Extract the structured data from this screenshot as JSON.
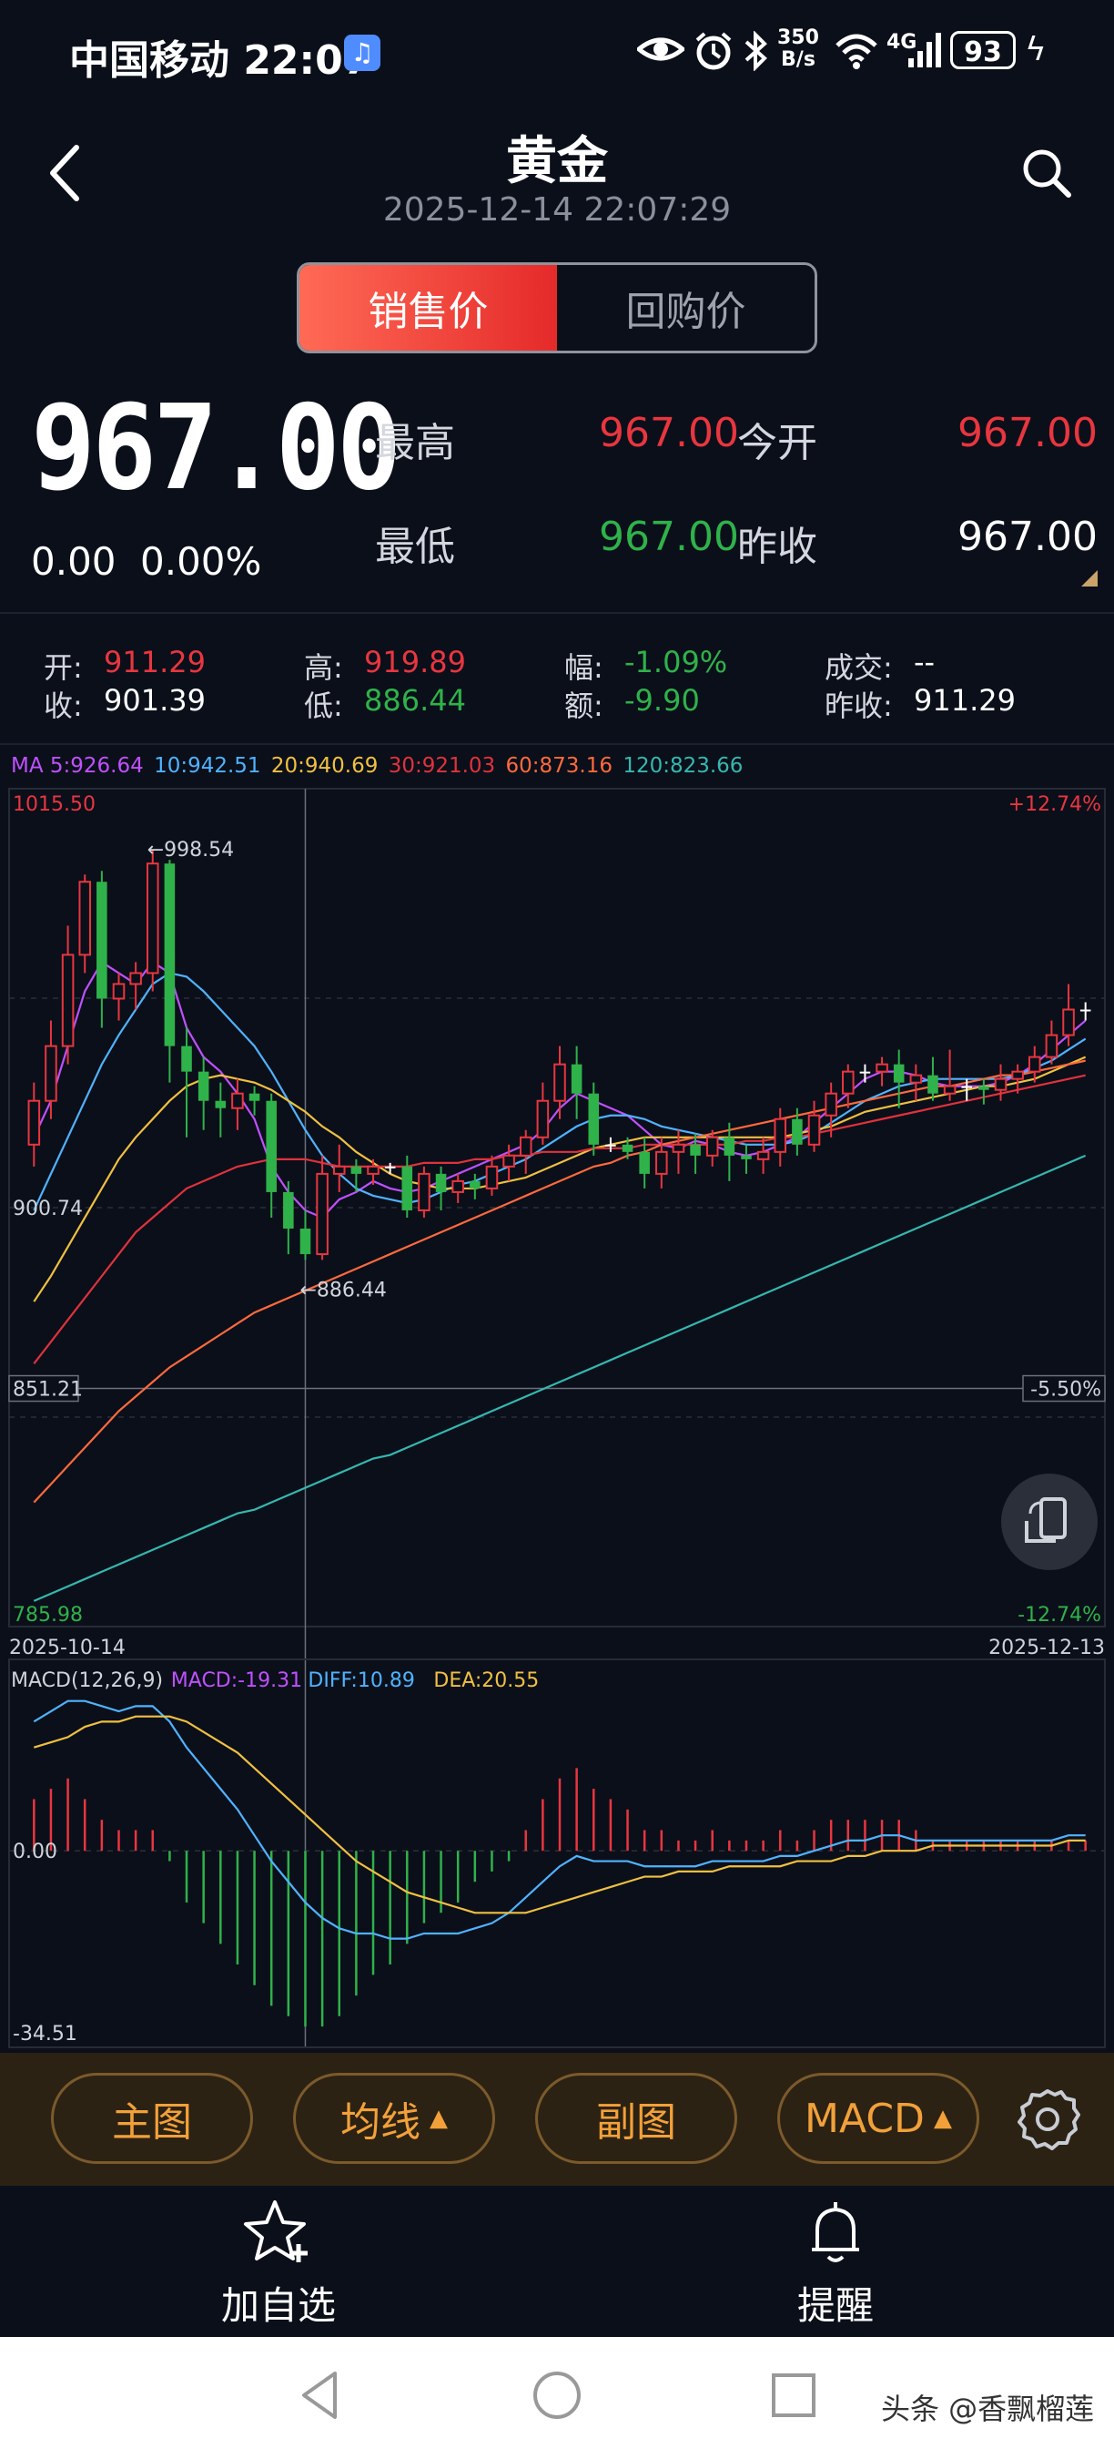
{
  "status_bar": {
    "carrier_time": "中国移动 22:07",
    "net_speed_value": "350",
    "net_speed_unit": "B/s",
    "network": "4G",
    "battery": "93"
  },
  "header": {
    "title": "黄金",
    "datetime": "2025-12-14 22:07:29"
  },
  "tabs": [
    {
      "label": "销售价",
      "active": true
    },
    {
      "label": "回购价",
      "active": false
    }
  ],
  "quote": {
    "price": "967.00",
    "change": "0.00",
    "change_pct": "0.00%",
    "high_label": "最高",
    "high": "967.00",
    "low_label": "最低",
    "low": "967.00",
    "open_label": "今开",
    "open": "967.00",
    "prev_close_label": "昨收",
    "prev_close": "967.00"
  },
  "ohlc": {
    "open_label": "开:",
    "open": "911.29",
    "close_label": "收:",
    "close": "901.39",
    "high_label": "高:",
    "high": "919.89",
    "low_label": "低:",
    "low": "886.44",
    "range_label": "幅:",
    "range": "-1.09%",
    "amount_label": "额:",
    "amount": "-9.90",
    "volume_label": "成交:",
    "volume": "--",
    "prev_close_label": "昨收:",
    "prev_close": "911.29"
  },
  "ma_legend": {
    "ma5": "MA 5:926.64",
    "ma10": "10:942.51",
    "ma20": "20:940.69",
    "ma30": "30:921.03",
    "ma60": "60:873.16",
    "ma120": "120:823.66"
  },
  "colors": {
    "ma5": "#c050ff",
    "ma10": "#4fb3ff",
    "ma20": "#f0c040",
    "ma30": "#e0323c",
    "ma60": "#ff6a3d",
    "ma120": "#34b8b0",
    "up": "#e8363f",
    "down": "#2fb24a",
    "accent": "#f2a13a"
  },
  "chart_data": [
    {
      "type": "candlestick",
      "title": "",
      "ylim": [
        785.98,
        1015.5
      ],
      "y_labels": [
        "1015.50",
        "900.74",
        "851.21",
        "785.98"
      ],
      "pct_labels": [
        "+12.74%",
        "-5.50%",
        "-12.74%"
      ],
      "x_range": [
        "2025-10-14",
        "2025-12-13"
      ],
      "annotations": [
        "←998.54",
        "←886.44"
      ],
      "candles": [
        [
          918,
          930,
          912,
          935
        ],
        [
          930,
          945,
          925,
          952
        ],
        [
          945,
          970,
          940,
          978
        ],
        [
          970,
          990,
          965,
          992
        ],
        [
          990,
          958,
          950,
          993
        ],
        [
          958,
          962,
          952,
          965
        ],
        [
          962,
          965,
          955,
          968
        ],
        [
          965,
          995,
          960,
          998.54
        ],
        [
          995,
          945,
          935,
          996
        ],
        [
          945,
          938,
          920,
          950
        ],
        [
          938,
          930,
          922,
          942
        ],
        [
          930,
          928,
          920,
          935
        ],
        [
          928,
          932,
          922,
          936
        ],
        [
          932,
          930,
          926,
          934
        ],
        [
          930,
          905,
          898,
          932
        ],
        [
          905,
          895,
          888,
          908
        ],
        [
          895,
          888,
          886.44,
          900
        ],
        [
          888,
          910,
          886.44,
          915
        ],
        [
          910,
          912,
          905,
          918
        ],
        [
          912,
          910,
          905,
          914
        ],
        [
          910,
          912,
          907,
          914
        ],
        [
          912,
          912,
          910,
          913
        ],
        [
          912,
          900,
          898,
          915
        ],
        [
          900,
          910,
          898,
          912
        ],
        [
          910,
          905,
          900,
          912
        ],
        [
          905,
          908,
          902,
          910
        ],
        [
          908,
          906,
          903,
          910
        ],
        [
          906,
          912,
          904,
          915
        ],
        [
          912,
          915,
          908,
          918
        ],
        [
          915,
          920,
          910,
          922
        ],
        [
          920,
          930,
          918,
          935
        ],
        [
          930,
          940,
          925,
          945
        ],
        [
          940,
          932,
          925,
          945
        ],
        [
          932,
          918,
          915,
          935
        ],
        [
          918,
          918,
          916,
          920
        ],
        [
          918,
          916,
          914,
          920
        ],
        [
          916,
          910,
          906,
          920
        ],
        [
          910,
          916,
          906,
          920
        ],
        [
          916,
          918,
          910,
          922
        ],
        [
          918,
          915,
          910,
          921
        ],
        [
          915,
          920,
          912,
          922
        ],
        [
          920,
          915,
          908,
          924
        ],
        [
          915,
          914,
          910,
          918
        ],
        [
          914,
          916,
          910,
          920
        ],
        [
          916,
          925,
          912,
          928
        ],
        [
          925,
          918,
          915,
          928
        ],
        [
          918,
          926,
          916,
          930
        ],
        [
          926,
          932,
          920,
          935
        ],
        [
          932,
          938,
          928,
          940
        ],
        [
          938,
          938,
          935,
          940
        ],
        [
          938,
          940,
          934,
          942
        ],
        [
          940,
          935,
          928,
          944
        ],
        [
          935,
          937,
          930,
          940
        ],
        [
          937,
          932,
          930,
          942
        ],
        [
          932,
          934,
          930,
          944
        ],
        [
          934,
          934,
          930,
          936
        ],
        [
          934,
          933,
          929,
          936
        ],
        [
          933,
          936,
          930,
          940
        ],
        [
          936,
          938,
          932,
          940
        ],
        [
          938,
          942,
          935,
          945
        ],
        [
          942,
          948,
          940,
          952
        ],
        [
          948,
          955,
          945,
          962
        ],
        [
          955,
          955,
          952,
          957
        ]
      ],
      "series": [
        {
          "name": "MA 5",
          "color": "#c050ff",
          "values": [
            920,
            930,
            945,
            960,
            968,
            965,
            962,
            968,
            965,
            950,
            942,
            938,
            932,
            925,
            912,
            905,
            900,
            898,
            903,
            905,
            908,
            906,
            905,
            906,
            908,
            910,
            912,
            914,
            916,
            918,
            922,
            928,
            932,
            930,
            928,
            926,
            922,
            918,
            917,
            919,
            918,
            916,
            915,
            916,
            918,
            920,
            924,
            928,
            932,
            936,
            938,
            938,
            937,
            935,
            934,
            934,
            934,
            935,
            937,
            940,
            944,
            948,
            952
          ]
        },
        {
          "name": "10",
          "color": "#4fb3ff",
          "values": [
            900,
            910,
            920,
            930,
            940,
            948,
            955,
            962,
            965,
            964,
            960,
            955,
            950,
            945,
            938,
            930,
            922,
            915,
            910,
            906,
            904,
            903,
            902,
            903,
            905,
            907,
            908,
            910,
            912,
            914,
            917,
            920,
            923,
            925,
            926,
            926,
            925,
            923,
            922,
            921,
            920,
            919,
            918,
            918,
            918,
            919,
            921,
            924,
            927,
            930,
            932,
            934,
            935,
            936,
            936,
            936,
            936,
            936,
            937,
            939,
            941,
            944,
            947
          ]
        },
        {
          "name": "20",
          "color": "#f0c040",
          "values": [
            875,
            882,
            890,
            898,
            906,
            914,
            920,
            925,
            930,
            934,
            936,
            937,
            936,
            935,
            933,
            930,
            927,
            923,
            920,
            916,
            913,
            910,
            908,
            907,
            906,
            906,
            906,
            907,
            908,
            909,
            911,
            913,
            915,
            917,
            918,
            919,
            920,
            920,
            920,
            920,
            920,
            920,
            920,
            920,
            920,
            921,
            922,
            923,
            925,
            927,
            928,
            929,
            930,
            931,
            932,
            933,
            934,
            934,
            935,
            936,
            938,
            940,
            942
          ]
        },
        {
          "name": "30",
          "color": "#e0323c",
          "values": [
            858,
            864,
            870,
            876,
            882,
            888,
            894,
            898,
            902,
            906,
            908,
            910,
            912,
            913,
            914,
            914,
            914,
            913,
            912,
            912,
            912,
            912,
            912,
            913,
            913,
            913,
            914,
            914,
            915,
            915,
            916,
            916,
            916,
            917,
            917,
            917,
            918,
            918,
            918,
            918,
            918,
            918,
            919,
            919,
            920,
            920,
            921,
            922,
            923,
            924,
            925,
            926,
            927,
            928,
            929,
            930,
            931,
            932,
            933,
            934,
            935,
            936,
            937
          ]
        },
        {
          "name": "60",
          "color": "#ff6a3d",
          "values": [
            820,
            825,
            830,
            835,
            840,
            845,
            849,
            853,
            857,
            860,
            863,
            866,
            869,
            872,
            874,
            876,
            878,
            880,
            882,
            884,
            886,
            888,
            890,
            892,
            894,
            896,
            898,
            900,
            902,
            904,
            906,
            908,
            910,
            912,
            913,
            915,
            916,
            918,
            919,
            920,
            921,
            922,
            923,
            924,
            925,
            926,
            927,
            928,
            929,
            930,
            931,
            932,
            933,
            934,
            934,
            935,
            936,
            937,
            937,
            938,
            939,
            940,
            941
          ]
        },
        {
          "name": "120",
          "color": "#34b8b0",
          "values": [
            793,
            795,
            797,
            799,
            801,
            803,
            805,
            807,
            809,
            811,
            813,
            815,
            817,
            818,
            820,
            822,
            824,
            826,
            828,
            830,
            832,
            833,
            835,
            837,
            839,
            841,
            843,
            845,
            847,
            849,
            851,
            853,
            855,
            857,
            859,
            861,
            863,
            865,
            867,
            869,
            871,
            873,
            875,
            877,
            879,
            881,
            883,
            885,
            887,
            889,
            891,
            893,
            895,
            897,
            899,
            901,
            903,
            905,
            907,
            909,
            911,
            913,
            915
          ]
        }
      ]
    },
    {
      "type": "macd",
      "legend": {
        "label": "MACD(12,26,9)",
        "macd": "MACD:-19.31",
        "diff": "DIFF:10.89",
        "dea": "DEA:20.55"
      },
      "y_labels": [
        "0.00",
        "-34.51"
      ],
      "ylim": [
        -34.51,
        30
      ],
      "diff": [
        25,
        27,
        29,
        29,
        28,
        27,
        28,
        28,
        25,
        20,
        16,
        12,
        8,
        3,
        -2,
        -6,
        -10,
        -13,
        -15,
        -16,
        -16,
        -17,
        -17,
        -16,
        -16,
        -16,
        -15,
        -14,
        -12,
        -9,
        -6,
        -3,
        -1,
        -2,
        -2,
        -2,
        -3,
        -3,
        -3,
        -3,
        -2,
        -2,
        -2,
        -2,
        -1,
        -1,
        0,
        1,
        2,
        2,
        3,
        3,
        2,
        2,
        2,
        2,
        2,
        2,
        2,
        2,
        2,
        3,
        3
      ],
      "dea": [
        20,
        21,
        22,
        24,
        25,
        25,
        26,
        26,
        26,
        25,
        23,
        21,
        19,
        16,
        13,
        10,
        7,
        4,
        1,
        -2,
        -4,
        -6,
        -8,
        -9,
        -10,
        -11,
        -12,
        -12,
        -12,
        -12,
        -11,
        -10,
        -9,
        -8,
        -7,
        -6,
        -5,
        -5,
        -4,
        -4,
        -4,
        -3,
        -3,
        -3,
        -3,
        -2,
        -2,
        -2,
        -1,
        -1,
        0,
        0,
        0,
        1,
        1,
        1,
        1,
        1,
        1,
        1,
        1,
        2,
        2
      ],
      "hist": [
        10,
        12,
        14,
        10,
        6,
        4,
        4,
        4,
        -2,
        -10,
        -14,
        -18,
        -22,
        -26,
        -30,
        -32,
        -34,
        -34,
        -32,
        -28,
        -24,
        -22,
        -18,
        -14,
        -12,
        -10,
        -6,
        -4,
        -2,
        4,
        10,
        14,
        16,
        12,
        10,
        8,
        4,
        4,
        2,
        2,
        4,
        2,
        2,
        2,
        4,
        2,
        4,
        6,
        6,
        6,
        6,
        6,
        4,
        2,
        2,
        2,
        2,
        2,
        2,
        2,
        2,
        2,
        2
      ]
    }
  ],
  "toolbar": {
    "main_chart": "主图",
    "ma_lines": "均线",
    "sub_chart": "副图",
    "macd": "MACD"
  },
  "bottom_nav": {
    "add_watchlist": "加自选",
    "alert": "提醒"
  },
  "watermark": "头条 @香飘榴莲"
}
